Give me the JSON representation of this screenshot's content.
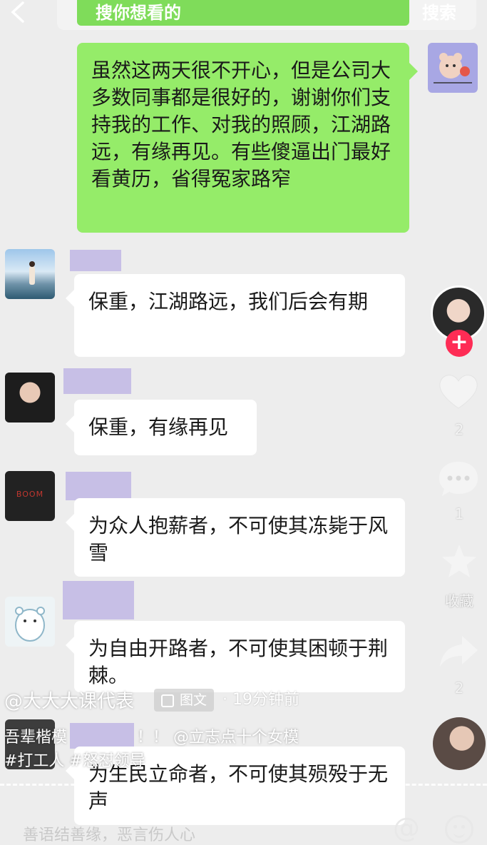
{
  "header": {
    "back_icon": "chevron-left-icon",
    "search_placeholder": "搜你想看的",
    "search_button": "搜索"
  },
  "chat": {
    "my_message": "虽然这两天很不开心，但是公司大多数同事都是很好的，谢谢你们支持我的工作、对我的照顾，江湖路远，有缘再见。有些傻逼出门最好看黄历，省得冤家路窄",
    "replies": [
      {
        "text": "保重，江湖路远，我们后会有期"
      },
      {
        "text": "保重，有缘再见"
      },
      {
        "text": "为众人抱薪者，不可使其冻毙于风雪"
      },
      {
        "text": "为自由开路者，不可使其困顿于荆棘。"
      },
      {
        "text": "为生民立命者，不可使其殒殁于无声"
      }
    ],
    "avatar3_text": "BOOM"
  },
  "rail": {
    "like_count": "2",
    "comment_count": "1",
    "favorite_label": "收藏",
    "share_count": "2"
  },
  "overlay": {
    "author": "@大大大课代表",
    "tag_label": "图文",
    "time": "· 19分钟前",
    "caption_start": "吾辈楷模",
    "caption_end": "！！ @立志点十个女模",
    "hashtags": "#打工人 #怒怼领导"
  },
  "comment_bar": {
    "placeholder": "善语结善缘，恶言伤人心",
    "at_symbol": "@"
  },
  "colors": {
    "green_bubble": "#95ec69",
    "name_redaction": "#c7bfe6",
    "follow_red": "#fe2c55"
  }
}
